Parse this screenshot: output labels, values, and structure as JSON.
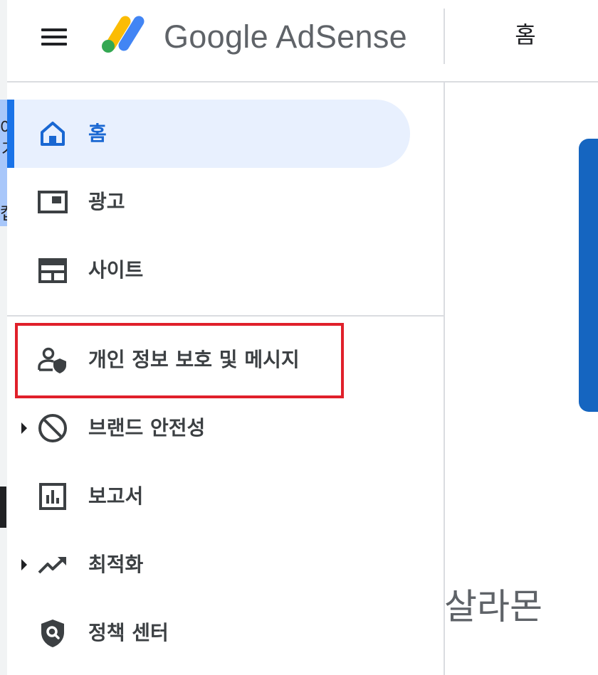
{
  "edge_fragments": [
    "어",
    "가",
    "캡"
  ],
  "header": {
    "brand": "Google AdSense",
    "title": "홈"
  },
  "sidebar": {
    "items": [
      {
        "label": "홈",
        "icon": "home-icon",
        "active": true
      },
      {
        "label": "광고",
        "icon": "ads-icon"
      },
      {
        "label": "사이트",
        "icon": "sites-icon"
      },
      {
        "label": "개인 정보 보호 및 메시지",
        "icon": "privacy-messaging-icon",
        "highlighted": true
      },
      {
        "label": "브랜드 안전성",
        "icon": "block-icon",
        "expandable": true
      },
      {
        "label": "보고서",
        "icon": "reports-icon"
      },
      {
        "label": "최적화",
        "icon": "trending-up-icon",
        "expandable": true
      },
      {
        "label": "정책 센터",
        "icon": "policy-center-icon"
      }
    ]
  },
  "main": {
    "owner_name": "살라몬"
  },
  "colors": {
    "accent": "#1a73e8",
    "active_bg": "#e8f0fe",
    "highlight_border": "#e0202a",
    "card": "#1565c0",
    "logo_yellow": "#fbbc04",
    "logo_blue": "#4285f4",
    "logo_green": "#34a853"
  }
}
